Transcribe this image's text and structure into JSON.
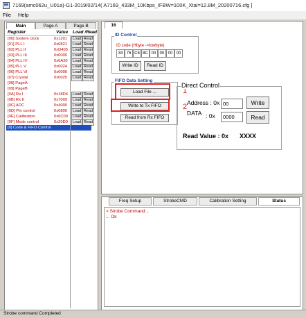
{
  "window": {
    "title": "7169(amc062u_U01a)-G1-2019/02/14( A7169_433M_10Kbps_IFBW=100K_Xtal=12.8M_20200716.cfg ]"
  },
  "menu": {
    "file": "File",
    "help": "Help"
  },
  "left_tabs": [
    "Main",
    "Page A",
    "Page B"
  ],
  "reg_table": {
    "headers": {
      "register": "Register",
      "value": "Value",
      "action": "Load /Read"
    },
    "load_label": "Load",
    "read_label": "Read",
    "rows": [
      {
        "name": "[00] System clock",
        "value": "0x1201"
      },
      {
        "name": "[01] PLL I",
        "value": "0x0821"
      },
      {
        "name": "[02] PLL II",
        "value": "0xD405"
      },
      {
        "name": "[03] PLL III",
        "value": "0x0000"
      },
      {
        "name": "[04] PLL IV",
        "value": "0x0A20"
      },
      {
        "name": "[05] PLL V",
        "value": "0x0024"
      },
      {
        "name": "[06] PLL VI",
        "value": "0x0000"
      },
      {
        "name": "[07] Crystal",
        "value": "0x0025"
      },
      {
        "name": "[08] PageA",
        "value": ""
      },
      {
        "name": "[09] PageB",
        "value": ""
      },
      {
        "name": "[0A] Rx I",
        "value": "0x18D4"
      },
      {
        "name": "[0B] Rx II",
        "value": "0x7009"
      },
      {
        "name": "[0C] ADC",
        "value": "0x4000"
      },
      {
        "name": "[0D] Pin control",
        "value": "0x0800"
      },
      {
        "name": "[0E] Calibration",
        "value": "0x6C00"
      },
      {
        "name": "[0F] Mode control",
        "value": "0x20D0"
      },
      {
        "name": "[0] Code & FIFO Control",
        "value": ""
      }
    ]
  },
  "right_tab": "16",
  "id_code": {
    "group_title": "ID Control",
    "label": "ID code (Hbyte ->lowbyte)",
    "bytes": [
      "34",
      "75",
      "C5",
      "8C",
      "00",
      "00",
      "00",
      "00"
    ],
    "write_btn": "Write ID",
    "read_btn": "Read ID"
  },
  "fifo": {
    "group_title": "FIFO Data Setting",
    "load_btn": "Load File ...",
    "write_btn": "Write to Tx FIFO",
    "read_btn": "Read from Rx FIFO"
  },
  "annotations": {
    "one": "1",
    "two": "2"
  },
  "direct_control": {
    "title": "Direct Control",
    "address_label": "Address : 0x",
    "address_value": "00",
    "data_label": "DATA",
    "data_prefix": ": 0x",
    "data_value": "0000",
    "write_btn": "Write",
    "read_btn": "Read",
    "read_value_label": "Read Value : 0x",
    "read_value": "XXXX"
  },
  "bottom_tabs": [
    "Freq Setup",
    "StrobeCMD",
    "Calibration Setting",
    "Status"
  ],
  "log": {
    "lines": [
      "> Strobe Command...",
      "... Ok"
    ]
  },
  "status_bar": "Strobe command Completed",
  "colors": {
    "selection": "#1e4fbf",
    "register_text": "#c00000",
    "annotation": "#e02020",
    "group_title": "#1e3f9a"
  }
}
